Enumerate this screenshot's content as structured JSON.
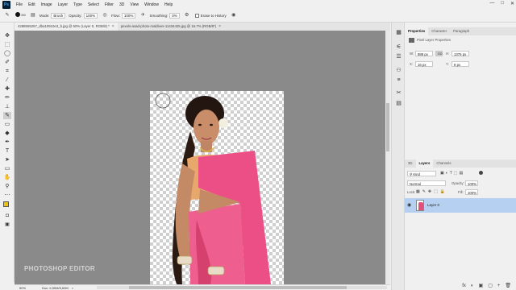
{
  "menubar": {
    "logo": "Ps",
    "items": [
      "File",
      "Edit",
      "Image",
      "Layer",
      "Type",
      "Select",
      "Filter",
      "3D",
      "View",
      "Window",
      "Help"
    ],
    "controls": [
      "—",
      "□",
      "✕"
    ]
  },
  "options": {
    "brush_size": "300",
    "mode_label": "Mode:",
    "mode_value": "Brush",
    "opacity_label": "Opacity:",
    "opacity_value": "100%",
    "flow_label": "Flow:",
    "flow_value": "100%",
    "smoothing_label": "Smoothing:",
    "smoothing_value": "0%",
    "erase_history_label": "Erase to History"
  },
  "tabs": [
    {
      "label": "4288555257_dba10910e3_b.jpg @ 50% (Layer 0, RGB/8) *",
      "close": "×"
    },
    {
      "label": "pexels-asad-photo-maldives-11434425.jpg @ 16.7% (RGB/8*)",
      "close": "×"
    }
  ],
  "canvas": {
    "watermark": "PHOTOSHOP EDITOR"
  },
  "status": {
    "zoom": "50%",
    "doc_info": "Doc: 6,50M/5,60M",
    "arrow": ">"
  },
  "properties": {
    "tabs": [
      "Properties",
      "Character",
      "Paragraph"
    ],
    "section_title": "Pixel Layer Properties",
    "w_label": "W:",
    "w_value": "888 px",
    "go_label": "GO",
    "h_label": "H:",
    "h_value": "1375 px",
    "x_label": "X:",
    "x_value": "16 px",
    "y_label": "Y:",
    "y_value": "8 px"
  },
  "layers": {
    "tabs": [
      "3D",
      "Layers",
      "Channels"
    ],
    "filter_kind": "Kind",
    "blend_mode": "Normal",
    "opacity_label": "Opacity:",
    "opacity_value": "100%",
    "lock_label": "Lock:",
    "fill_label": "Fill:",
    "fill_value": "100%",
    "layer_name": "Layer 0",
    "bottom_icons": [
      "fx",
      "◐",
      "▣",
      "▢",
      "+",
      "🗑"
    ]
  },
  "colors": {
    "foreground": "#f2c200",
    "background": "#1a1a1a",
    "saree_pink": "#ec4f86",
    "canvas_bg": "#8a8a8a",
    "layer_selected": "#b5d0f0"
  }
}
